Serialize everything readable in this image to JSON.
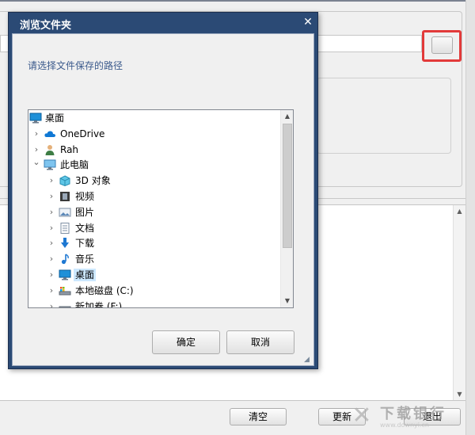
{
  "dialog": {
    "title": "浏览文件夹",
    "close_glyph": "✕",
    "prompt": "请选择文件保存的路径",
    "ok_label": "确定",
    "cancel_label": "取消"
  },
  "tree": {
    "items": [
      {
        "label": "桌面",
        "icon": "desktop-icon",
        "expander": ""
      },
      {
        "label": "OneDrive",
        "icon": "cloud-icon",
        "expander": "›"
      },
      {
        "label": "Rah",
        "icon": "user-icon",
        "expander": "›"
      },
      {
        "label": "此电脑",
        "icon": "computer-icon",
        "expander": "⌄"
      },
      {
        "label": "3D 对象",
        "icon": "cube-icon",
        "expander": "›"
      },
      {
        "label": "视频",
        "icon": "video-icon",
        "expander": "›"
      },
      {
        "label": "图片",
        "icon": "pictures-icon",
        "expander": "›"
      },
      {
        "label": "文档",
        "icon": "document-icon",
        "expander": "›"
      },
      {
        "label": "下载",
        "icon": "download-icon",
        "expander": "›"
      },
      {
        "label": "音乐",
        "icon": "music-icon",
        "expander": "›"
      },
      {
        "label": "桌面",
        "icon": "desktop-icon",
        "expander": "›",
        "selected": true
      },
      {
        "label": "本地磁盘 (C:)",
        "icon": "drive-c-icon",
        "expander": "›"
      },
      {
        "label": "新加卷 (F:)",
        "icon": "drive-icon",
        "expander": "›"
      }
    ]
  },
  "app": {
    "clear_label": "清空",
    "update_label": "更新",
    "exit_label": "退出"
  },
  "watermark": {
    "text": "下载银行",
    "sub": "www.downyi.cn"
  },
  "colors": {
    "dialog_frame": "#2b4a75",
    "selection": "#cce8ff",
    "highlight_box": "#e23a3a"
  }
}
